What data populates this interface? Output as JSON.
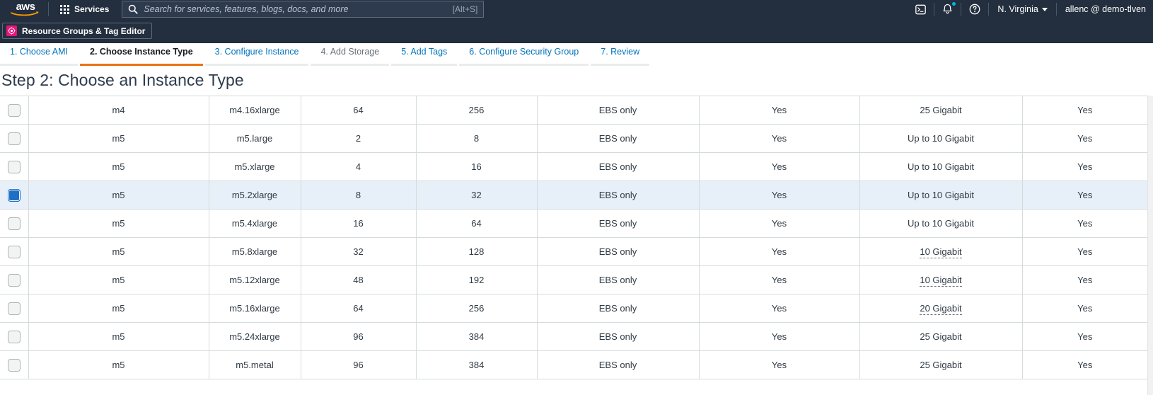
{
  "topnav": {
    "logo_text": "aws",
    "services_label": "Services",
    "search": {
      "placeholder": "Search for services, features, blogs, docs, and more",
      "value": "",
      "shortcut_hint": "[Alt+S]"
    },
    "cloudshell_icon": "terminal-icon",
    "notifications_icon": "bell-icon",
    "help_icon": "help-circle-icon",
    "region": "N. Virginia",
    "account": "allenc @ demo-tlven"
  },
  "subnav": {
    "favorite": {
      "label": "Resource Groups & Tag Editor",
      "icon": "resource-groups-icon",
      "icon_color": "#e7157b"
    }
  },
  "wizard": {
    "steps": [
      {
        "label": "1. Choose AMI",
        "state": "link"
      },
      {
        "label": "2. Choose Instance Type",
        "state": "active"
      },
      {
        "label": "3. Configure Instance",
        "state": "link"
      },
      {
        "label": "4. Add Storage",
        "state": "muted"
      },
      {
        "label": "5. Add Tags",
        "state": "link"
      },
      {
        "label": "6. Configure Security Group",
        "state": "link"
      },
      {
        "label": "7. Review",
        "state": "link"
      }
    ],
    "accent_color": "#ec7211",
    "link_color": "#0073bb"
  },
  "page": {
    "title": "Step 2: Choose an Instance Type"
  },
  "table": {
    "selected_row_index": 3,
    "selected_bg": "#e7f0f9",
    "rows": [
      {
        "selected": false,
        "family": "m4",
        "type": "m4.16xlarge",
        "vcpus": "64",
        "memory": "256",
        "storage": "EBS only",
        "ebs_optimized": "Yes",
        "network": "25 Gigabit",
        "network_tooltip": false,
        "ipv6": "Yes"
      },
      {
        "selected": false,
        "family": "m5",
        "type": "m5.large",
        "vcpus": "2",
        "memory": "8",
        "storage": "EBS only",
        "ebs_optimized": "Yes",
        "network": "Up to 10 Gigabit",
        "network_tooltip": false,
        "ipv6": "Yes"
      },
      {
        "selected": false,
        "family": "m5",
        "type": "m5.xlarge",
        "vcpus": "4",
        "memory": "16",
        "storage": "EBS only",
        "ebs_optimized": "Yes",
        "network": "Up to 10 Gigabit",
        "network_tooltip": false,
        "ipv6": "Yes"
      },
      {
        "selected": true,
        "family": "m5",
        "type": "m5.2xlarge",
        "vcpus": "8",
        "memory": "32",
        "storage": "EBS only",
        "ebs_optimized": "Yes",
        "network": "Up to 10 Gigabit",
        "network_tooltip": false,
        "ipv6": "Yes"
      },
      {
        "selected": false,
        "family": "m5",
        "type": "m5.4xlarge",
        "vcpus": "16",
        "memory": "64",
        "storage": "EBS only",
        "ebs_optimized": "Yes",
        "network": "Up to 10 Gigabit",
        "network_tooltip": false,
        "ipv6": "Yes"
      },
      {
        "selected": false,
        "family": "m5",
        "type": "m5.8xlarge",
        "vcpus": "32",
        "memory": "128",
        "storage": "EBS only",
        "ebs_optimized": "Yes",
        "network": "10 Gigabit",
        "network_tooltip": true,
        "ipv6": "Yes"
      },
      {
        "selected": false,
        "family": "m5",
        "type": "m5.12xlarge",
        "vcpus": "48",
        "memory": "192",
        "storage": "EBS only",
        "ebs_optimized": "Yes",
        "network": "10 Gigabit",
        "network_tooltip": true,
        "ipv6": "Yes"
      },
      {
        "selected": false,
        "family": "m5",
        "type": "m5.16xlarge",
        "vcpus": "64",
        "memory": "256",
        "storage": "EBS only",
        "ebs_optimized": "Yes",
        "network": "20 Gigabit",
        "network_tooltip": true,
        "ipv6": "Yes"
      },
      {
        "selected": false,
        "family": "m5",
        "type": "m5.24xlarge",
        "vcpus": "96",
        "memory": "384",
        "storage": "EBS only",
        "ebs_optimized": "Yes",
        "network": "25 Gigabit",
        "network_tooltip": false,
        "ipv6": "Yes"
      },
      {
        "selected": false,
        "family": "m5",
        "type": "m5.metal",
        "vcpus": "96",
        "memory": "384",
        "storage": "EBS only",
        "ebs_optimized": "Yes",
        "network": "25 Gigabit",
        "network_tooltip": false,
        "ipv6": "Yes"
      }
    ]
  }
}
